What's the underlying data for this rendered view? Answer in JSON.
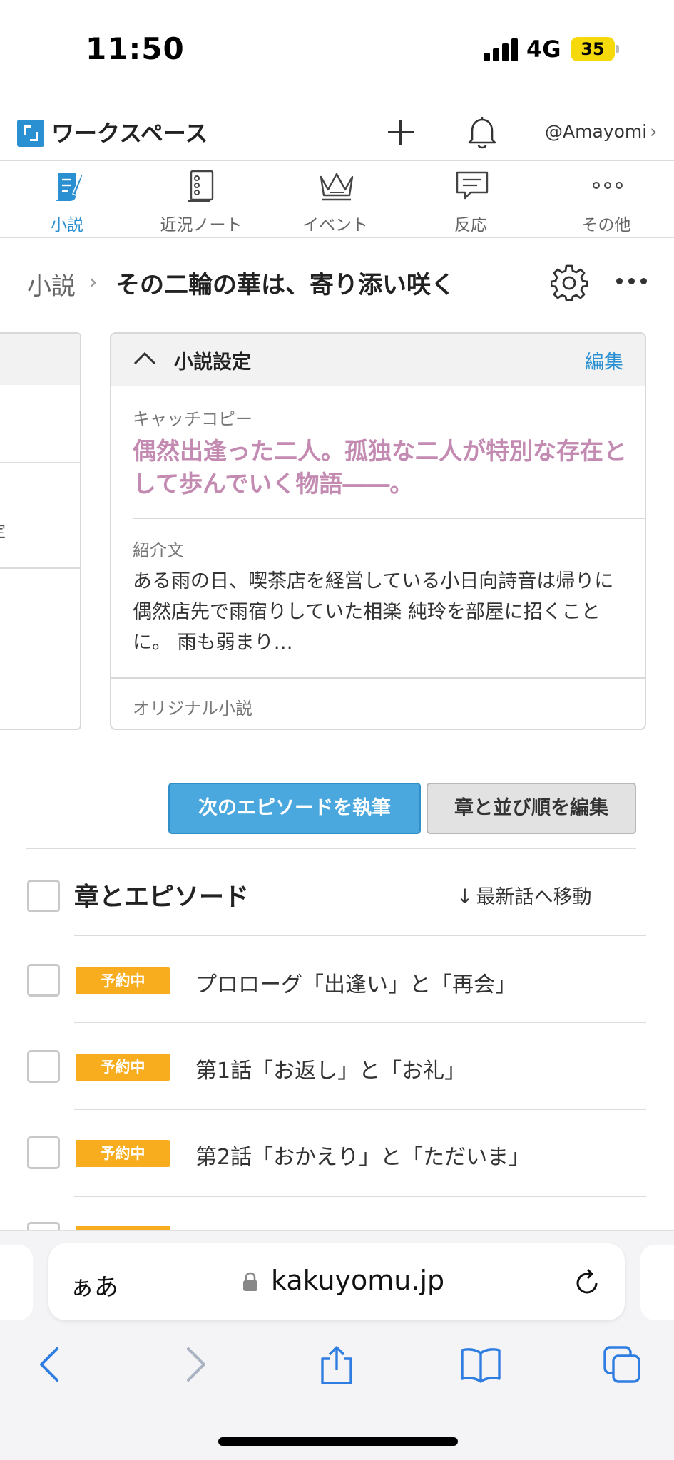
{
  "status_bar": {
    "time": "11:50",
    "network": "4G",
    "battery": "35"
  },
  "header": {
    "workspace_title": "ワークスペース",
    "user": "@Amayomi"
  },
  "tabs": [
    {
      "label": "小説",
      "icon": "quill-scroll-icon",
      "active": true
    },
    {
      "label": "近況ノート",
      "icon": "notebook-icon",
      "active": false
    },
    {
      "label": "イベント",
      "icon": "crown-icon",
      "active": false
    },
    {
      "label": "反応",
      "icon": "comment-icon",
      "active": false
    },
    {
      "label": "その他",
      "icon": "more-dots-icon",
      "active": false
    }
  ],
  "title_row": {
    "breadcrumb": "小説",
    "novel_title": "その二輪の華は、寄り添い咲く"
  },
  "settings_card": {
    "title": "小説設定",
    "edit_label": "編集",
    "catchcopy_label": "キャッチコピー",
    "catchcopy": "偶然出逢った二人。孤独な二人が特別な存在として歩んでいく物語――。",
    "intro_label": "紹介文",
    "intro": "ある雨の日、喫茶店を経営している小日向詩音は帰りに偶然店先で雨宿りしていた相楽 純玲を部屋に招くことに。 雨も弱まり…",
    "genre": "オリジナル小説"
  },
  "left_panel": {
    "partial_char": "定"
  },
  "actions": {
    "next_episode": "次のエピソードを執筆",
    "edit_order": "章と並び順を編集"
  },
  "episodes": {
    "header": "章とエピソード",
    "jump_latest": "最新話へ移動",
    "items": [
      {
        "badge": "予約中",
        "title": "プロローグ「出逢い」と「再会」"
      },
      {
        "badge": "予約中",
        "title": "第1話「お返し」と「お礼」"
      },
      {
        "badge": "予約中",
        "title": "第2話「おかえり」と「ただいま」"
      }
    ]
  },
  "browser": {
    "aa": "ぁあ",
    "url": "kakuyomu.jp"
  },
  "colors": {
    "accent": "#2a90d1",
    "badge": "#f7ad1e",
    "catchcopy": "#c48bb2",
    "primary_button": "#4aa8de"
  }
}
